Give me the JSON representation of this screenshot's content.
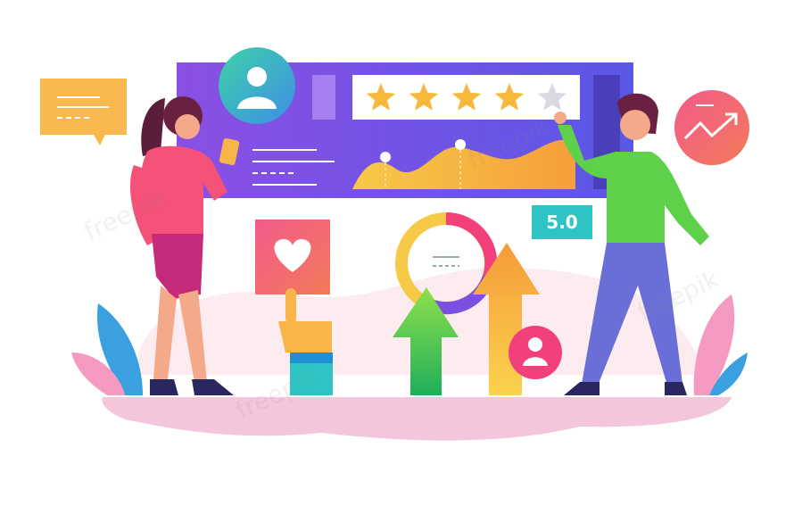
{
  "illustration": {
    "rating_badge": "5.0",
    "stars_total": 5,
    "stars_filled": 4,
    "watermark": "freepik",
    "colors": {
      "panel": "#7b4fe0",
      "star": "#f6b93b",
      "badge": "#2ec4c4",
      "chat_bubble": "#f9b94e",
      "trend_circle": "#f2407a",
      "ground": "#f4c6dc"
    }
  }
}
